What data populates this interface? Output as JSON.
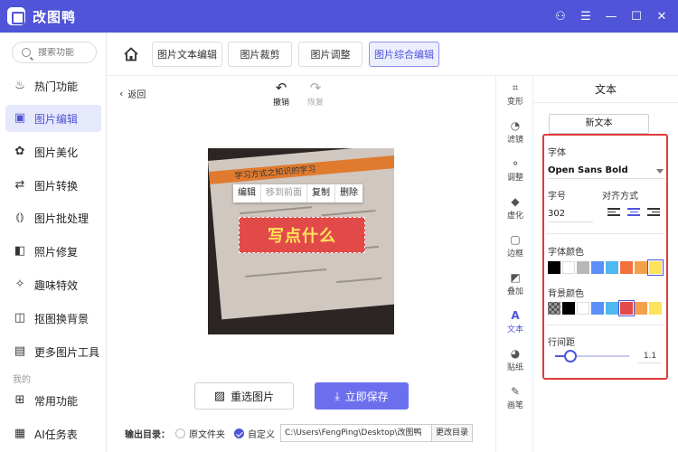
{
  "app": {
    "title": "改图鸭"
  },
  "window": {
    "min": "—",
    "max": "☐",
    "close": "✕",
    "extra": "☰",
    "pin": "⚇"
  },
  "sidebar": {
    "search_placeholder": "搜索功能",
    "items": [
      {
        "label": "热门功能",
        "icon": "flame-icon",
        "glyph": "♨"
      },
      {
        "label": "图片编辑",
        "icon": "image-edit-icon",
        "glyph": "▣"
      },
      {
        "label": "图片美化",
        "icon": "image-beautify-icon",
        "glyph": "✿"
      },
      {
        "label": "图片转换",
        "icon": "convert-icon",
        "glyph": "⇄"
      },
      {
        "label": "图片批处理",
        "icon": "batch-icon",
        "glyph": "⦅⦆"
      },
      {
        "label": "照片修复",
        "icon": "repair-icon",
        "glyph": "◧"
      },
      {
        "label": "趣味特效",
        "icon": "effects-icon",
        "glyph": "✧"
      },
      {
        "label": "抠图换背景",
        "icon": "cutout-icon",
        "glyph": "◫"
      },
      {
        "label": "更多图片工具",
        "icon": "toolbox-icon",
        "glyph": "▤"
      }
    ],
    "section_mine": "我的",
    "mine_items": [
      {
        "label": "常用功能",
        "icon": "grid-icon",
        "glyph": "⊞"
      },
      {
        "label": "AI任务表",
        "icon": "ai-task-icon",
        "glyph": "▦"
      }
    ]
  },
  "toolbar": {
    "tabs": [
      "图片文本编辑",
      "图片裁剪",
      "图片调整",
      "图片综合编辑"
    ],
    "active_tab": 3
  },
  "canvas": {
    "back": "返回",
    "undo": "撤销",
    "redo": "恢复",
    "context_menu": [
      "编辑",
      "移到前面",
      "复制",
      "删除"
    ],
    "text_content": "写点什么",
    "photo_text": "学习方式之知识的学习"
  },
  "actions": {
    "reselect": "重选图片",
    "save": "立即保存",
    "output_label": "输出目录：",
    "option_original": "原文件夹",
    "option_custom": "自定义",
    "output_path": "C:\\Users\\FengPing\\Desktop\\改图鸭",
    "change_dir": "更改目录"
  },
  "tools": [
    {
      "label": "变形",
      "glyph": "⌗"
    },
    {
      "label": "滤镜",
      "glyph": "◔"
    },
    {
      "label": "调整",
      "glyph": "⚬"
    },
    {
      "label": "虚化",
      "glyph": "◆"
    },
    {
      "label": "边框",
      "glyph": "▢"
    },
    {
      "label": "叠加",
      "glyph": "◩"
    },
    {
      "label": "文本",
      "glyph": "A"
    },
    {
      "label": "贴纸",
      "glyph": "◕"
    },
    {
      "label": "画笔",
      "glyph": "✎"
    }
  ],
  "active_tool": 6,
  "panel": {
    "title": "文本",
    "new_text": "新文本",
    "font_label": "字体",
    "font_value": "Open Sans Bold",
    "size_label": "字号",
    "size_value": "302",
    "align_label": "对齐方式",
    "font_color_label": "字体颜色",
    "bg_color_label": "背景颜色",
    "line_spacing_label": "行间距",
    "line_spacing_value": "1.1",
    "font_colors": [
      "#000000",
      "#ffffff",
      "#b8b8b8",
      "#5b8ff9",
      "#4fb8f0",
      "#f2703c",
      "#f5a048",
      "#fce35a"
    ],
    "bg_colors": [
      "transparent",
      "#000000",
      "#ffffff",
      "#5b8ff9",
      "#4fb8f0",
      "#e24a4a",
      "#f5a048",
      "#fce35a"
    ]
  }
}
